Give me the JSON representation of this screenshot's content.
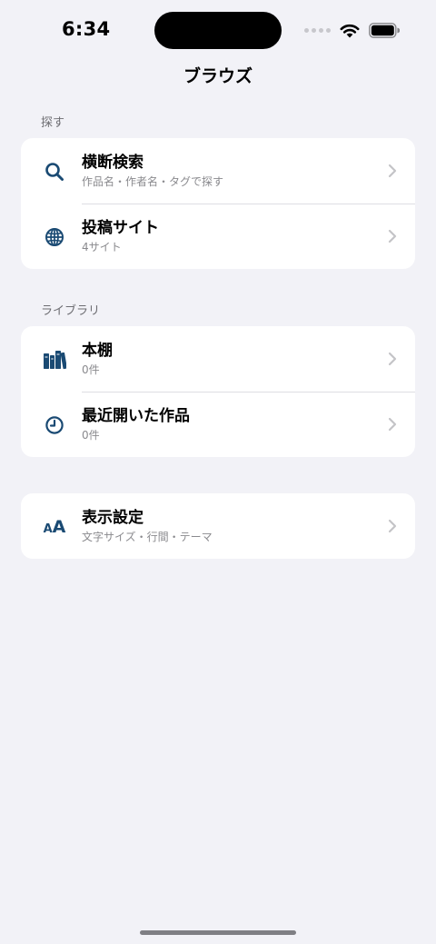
{
  "status_bar": {
    "time": "6:34"
  },
  "nav": {
    "title": "ブラウズ"
  },
  "sections": {
    "explore": {
      "header": "探す",
      "rows": [
        {
          "title": "横断検索",
          "subtitle": "作品名・作者名・タグで探す",
          "icon": "search-icon"
        },
        {
          "title": "投稿サイト",
          "subtitle": "4サイト",
          "icon": "globe-icon"
        }
      ]
    },
    "library": {
      "header": "ライブラリ",
      "rows": [
        {
          "title": "本棚",
          "subtitle": "0件",
          "icon": "bookshelf-icon"
        },
        {
          "title": "最近開いた作品",
          "subtitle": "0件",
          "icon": "clock-icon"
        }
      ]
    },
    "settings": {
      "rows": [
        {
          "title": "表示設定",
          "subtitle": "文字サイズ・行間・テーマ",
          "icon": "text-size-icon",
          "icon_text_small": "A",
          "icon_text_big": "A"
        }
      ]
    }
  },
  "colors": {
    "accent": "#1a4a73",
    "background": "#f2f2f7",
    "secondary_text": "#8a8a8e",
    "chevron": "#c4c4c7"
  }
}
